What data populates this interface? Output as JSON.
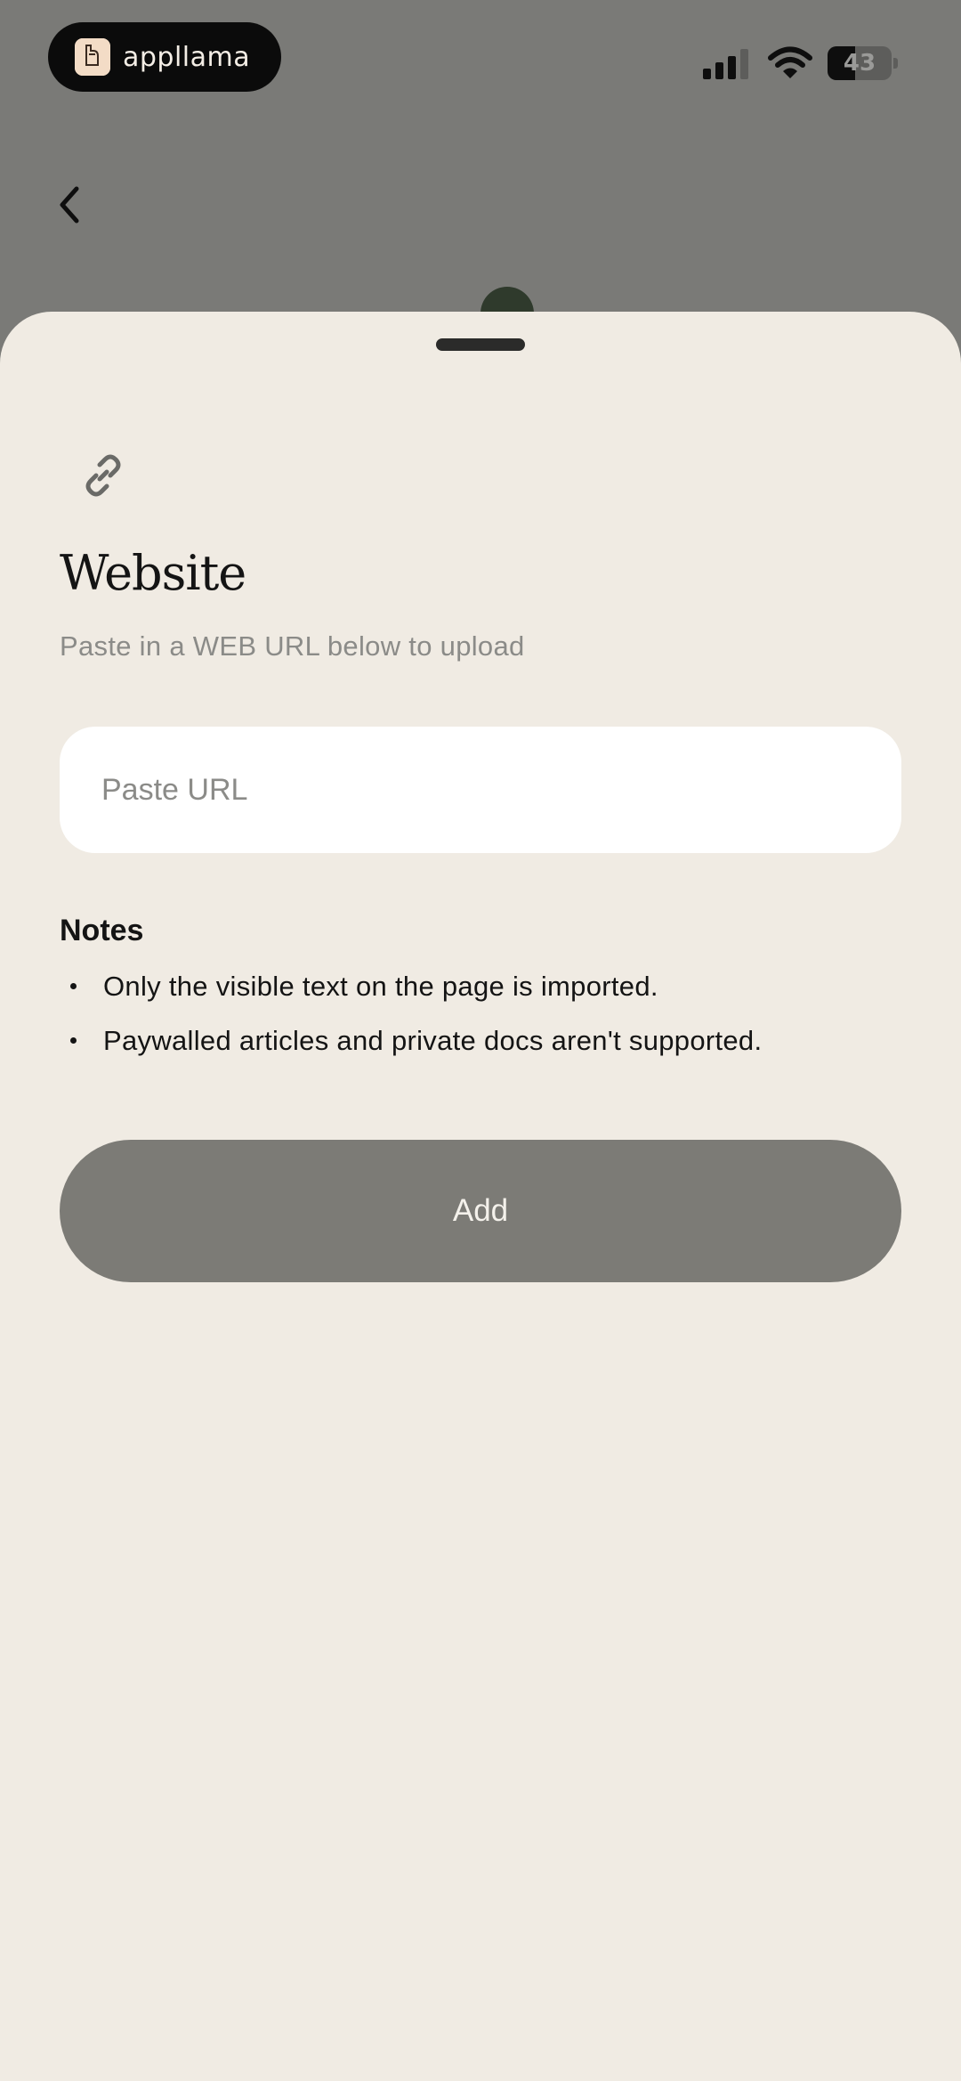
{
  "status_bar": {
    "app_name": "appllama",
    "battery_level": "43"
  },
  "icons": {
    "back": "chevron-left-icon",
    "link": "link-icon",
    "signal": "cellular-signal-icon",
    "wifi": "wifi-icon",
    "battery": "battery-icon"
  },
  "sheet": {
    "title": "Website",
    "subtitle": "Paste in a WEB URL below to upload",
    "url_input": {
      "value": "",
      "placeholder": "Paste URL"
    },
    "notes": {
      "heading": "Notes",
      "items": [
        "Only the visible text on the page is imported.",
        "Paywalled articles and private docs aren't supported."
      ]
    },
    "add_label": "Add"
  },
  "colors": {
    "overlay": "#7a7a77",
    "sheet_background": "#f0ebe3",
    "input_background": "#ffffff",
    "button_disabled": "#7c7b76",
    "text_primary": "#141414",
    "text_secondary": "#8b8b88"
  }
}
